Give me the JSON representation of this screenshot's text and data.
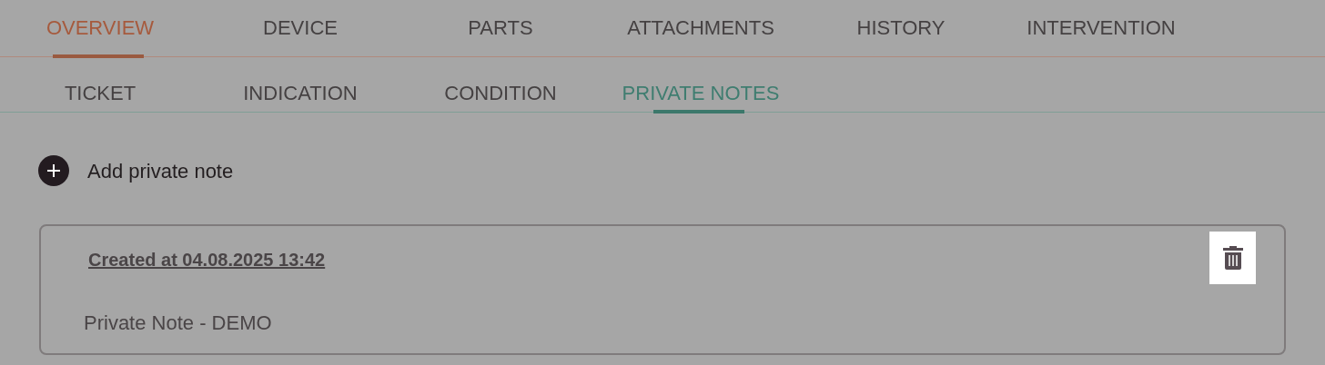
{
  "main_tabs": [
    {
      "label": "OVERVIEW",
      "selected": true
    },
    {
      "label": "DEVICE",
      "selected": false
    },
    {
      "label": "PARTS",
      "selected": false
    },
    {
      "label": "ATTACHMENTS",
      "selected": false
    },
    {
      "label": "HISTORY",
      "selected": false
    },
    {
      "label": "INTERVENTION",
      "selected": false
    }
  ],
  "sub_tabs": [
    {
      "label": "TICKET",
      "selected": false
    },
    {
      "label": "INDICATION",
      "selected": false
    },
    {
      "label": "CONDITION",
      "selected": false
    },
    {
      "label": "PRIVATE NOTES",
      "selected": true
    }
  ],
  "add_button": {
    "label": "Add private note"
  },
  "notes": [
    {
      "created": "Created at 04.08.2025 13:42",
      "text": "Private Note - DEMO"
    }
  ]
}
